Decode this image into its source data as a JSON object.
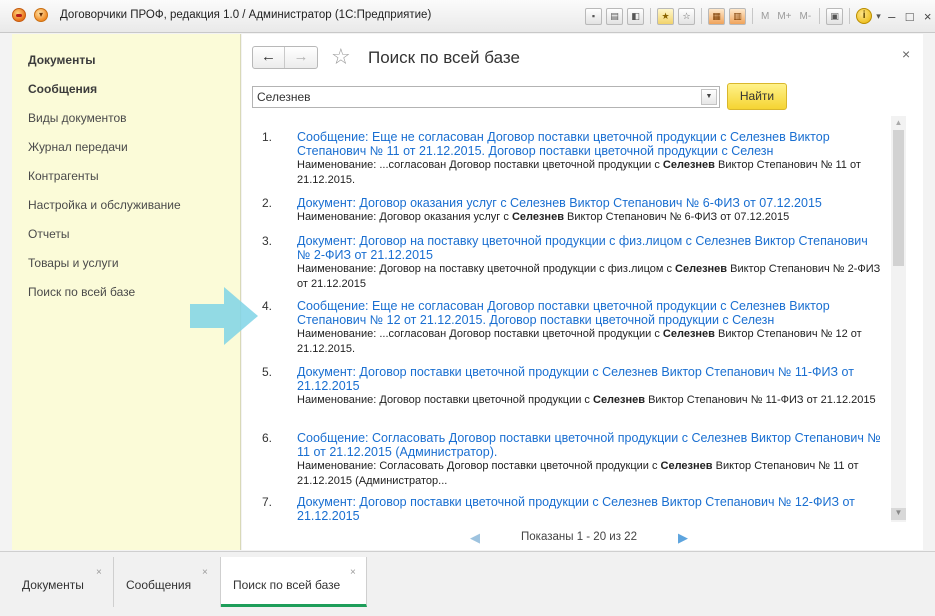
{
  "window": {
    "title": "Договорчики ПРОФ, редакция 1.0 / Администратор  (1С:Предприятие)",
    "toolbar_text_buttons": [
      "M",
      "M+",
      "M-"
    ],
    "controls": [
      "–",
      "□",
      "×"
    ]
  },
  "sidebar": {
    "items": [
      {
        "label": "Документы",
        "bold": true
      },
      {
        "label": "Сообщения",
        "bold": true
      },
      {
        "label": "Виды документов",
        "bold": false
      },
      {
        "label": "Журнал передачи",
        "bold": false
      },
      {
        "label": "Контрагенты",
        "bold": false
      },
      {
        "label": "Настройка и обслуживание",
        "bold": false
      },
      {
        "label": "Отчеты",
        "bold": false
      },
      {
        "label": "Товары и услуги",
        "bold": false
      },
      {
        "label": "Поиск по всей базе",
        "bold": false
      }
    ]
  },
  "form": {
    "title": "Поиск по всей базе",
    "close_glyph": "×",
    "search_value": "Селезнев",
    "find_button": "Найти"
  },
  "results": [
    {
      "num": "1.",
      "title": "Сообщение: Еще не согласован Договор поставки цветочной продукции с Селезнев Виктор Степанович № 11 от 21.12.2015. Договор поставки цветочной продукции с Селезн",
      "prefix": "Наименование: ...согласован Договор поставки цветочной продукции с ",
      "highlight": "Селезнев",
      "suffix": " Виктор Степанович № 11 от 21.12.2015."
    },
    {
      "num": "2.",
      "title": "Документ: Договор оказания услуг с Селезнев Виктор Степанович № 6-ФИЗ от 07.12.2015",
      "prefix": "Наименование: Договор оказания услуг с ",
      "highlight": "Селезнев",
      "suffix": " Виктор Степанович № 6-ФИЗ от 07.12.2015"
    },
    {
      "num": "3.",
      "title": "Документ: Договор на поставку цветочной продукции с физ.лицом с Селезнев Виктор Степанович № 2-ФИЗ от 21.12.2015",
      "prefix": "Наименование: Договор на поставку цветочной продукции с физ.лицом с ",
      "highlight": "Селезнев",
      "suffix": " Виктор Степанович № 2-ФИЗ от 21.12.2015"
    },
    {
      "num": "4.",
      "title": "Сообщение: Еще не согласован Договор поставки цветочной продукции с Селезнев Виктор Степанович № 12 от 21.12.2015. Договор поставки цветочной продукции с Селезн",
      "prefix": "Наименование: ...согласован Договор поставки цветочной продукции с ",
      "highlight": "Селезнев",
      "suffix": " Виктор Степанович № 12 от 21.12.2015."
    },
    {
      "num": "5.",
      "title": "Документ: Договор поставки цветочной продукции с Селезнев Виктор Степанович № 11-ФИЗ от 21.12.2015",
      "prefix": "Наименование: Договор поставки цветочной продукции с ",
      "highlight": "Селезнев",
      "suffix": " Виктор Степанович № 11-ФИЗ от 21.12.2015"
    },
    {
      "num": "6.",
      "title": "Сообщение: Согласовать Договор поставки цветочной продукции с Селезнев Виктор Степанович № 11 от 21.12.2015 (Администратор).",
      "prefix": "Наименование: Согласовать Договор поставки цветочной продукции с ",
      "highlight": "Селезнев",
      "suffix": " Виктор Степанович № 11 от 21.12.2015 (Администратор..."
    },
    {
      "num": "7.",
      "title": "Документ: Договор поставки цветочной продукции с Селезнев Виктор Степанович № 12-ФИЗ от 21.12.2015",
      "prefix": "",
      "highlight": "",
      "suffix": ""
    }
  ],
  "pager": {
    "text": "Показаны 1 - 20 из 22"
  },
  "tabs": [
    {
      "label": "Документы",
      "active": false
    },
    {
      "label": "Сообщения",
      "active": false
    },
    {
      "label": "Поиск по всей базе",
      "active": true
    }
  ],
  "colors": {
    "sidebar_bg": "#fbfbd8",
    "link": "#1a6fd1",
    "find_button": "#f5d432",
    "active_tab_underline": "#1e9e5a",
    "annotation_arrow": "#7fd4e6"
  }
}
